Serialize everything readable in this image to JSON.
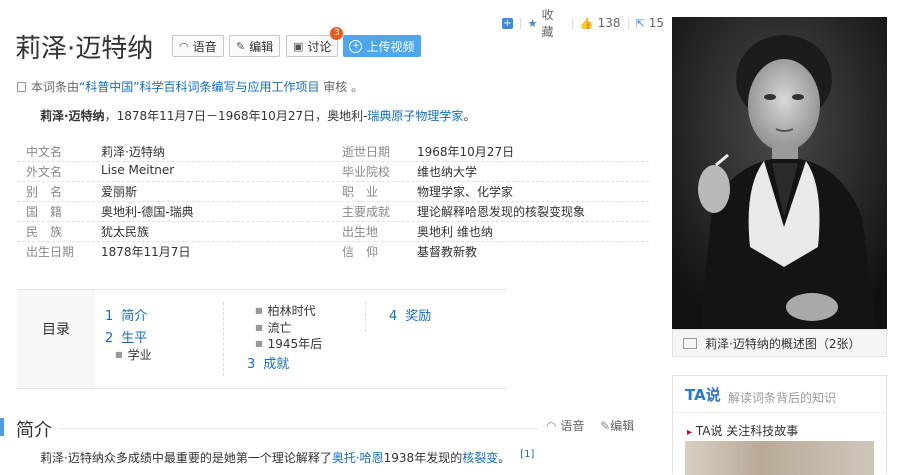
{
  "stats": {
    "collect_label": "收藏",
    "like_count": "138",
    "share_count": "15"
  },
  "title": "莉泽·迈特纳",
  "title_buttons": {
    "voice": "语音",
    "edit": "编辑",
    "discuss": "讨论",
    "discuss_badge": "3",
    "upload_video": "上传视频"
  },
  "credit": {
    "prefix": "本词条由",
    "org": "“科普中国”科学百科词条编写与应用工作项目",
    "suffix": " 审核 。"
  },
  "summary": {
    "name": "莉泽·迈特纳",
    "text": "，1878年11月7日－1968年10月27日，奥地利-",
    "link": "瑞典原子物理学家",
    "end": "。"
  },
  "info_left": [
    {
      "label": "中文名",
      "value": "莉泽·迈特纳"
    },
    {
      "label": "外文名",
      "value": "Lise Meitner"
    },
    {
      "label": "别　名",
      "value": "爱丽斯"
    },
    {
      "label": "国　籍",
      "value": "奥地利-德国-瑞典"
    },
    {
      "label": "民　族",
      "value": "犹太民族"
    },
    {
      "label": "出生日期",
      "value": "1878年11月7日"
    }
  ],
  "info_right": [
    {
      "label": "逝世日期",
      "value": "1968年10月27日"
    },
    {
      "label": "毕业院校",
      "value": "维也纳大学"
    },
    {
      "label": "职　业",
      "value": "物理学家、化学家",
      "link": true
    },
    {
      "label": "主要成就",
      "value": "理论解释哈恩发现的核裂变现象"
    },
    {
      "label": "出生地",
      "value": "奥地利 维也纳"
    },
    {
      "label": "信　仰",
      "value": "基督教新教"
    }
  ],
  "catalog": {
    "label": "目录",
    "l1": [
      {
        "num": "1",
        "text": "简介"
      },
      {
        "num": "2",
        "text": "生平"
      },
      {
        "num": "3",
        "text": "成就"
      },
      {
        "num": "4",
        "text": "奖励"
      }
    ],
    "l2": [
      "学业",
      "柏林时代",
      "流亡",
      "1945年后"
    ]
  },
  "section": {
    "title": "简介",
    "voice": "语音",
    "edit": "编辑",
    "text_start": "莉泽·迈特纳众多成绩中最重要的是她第一个理论解释了",
    "link1": "奥托·哈恩",
    "text_mid": "1938年发现的",
    "link2": "核裂变",
    "text_end": "。",
    "ref": "[1]"
  },
  "photo": {
    "caption": "莉泽·迈特纳的概述图（2张）"
  },
  "ta": {
    "logo": "TA说",
    "subtitle": "解读词条背后的知识",
    "follow": "TA说  关注科技故事"
  }
}
